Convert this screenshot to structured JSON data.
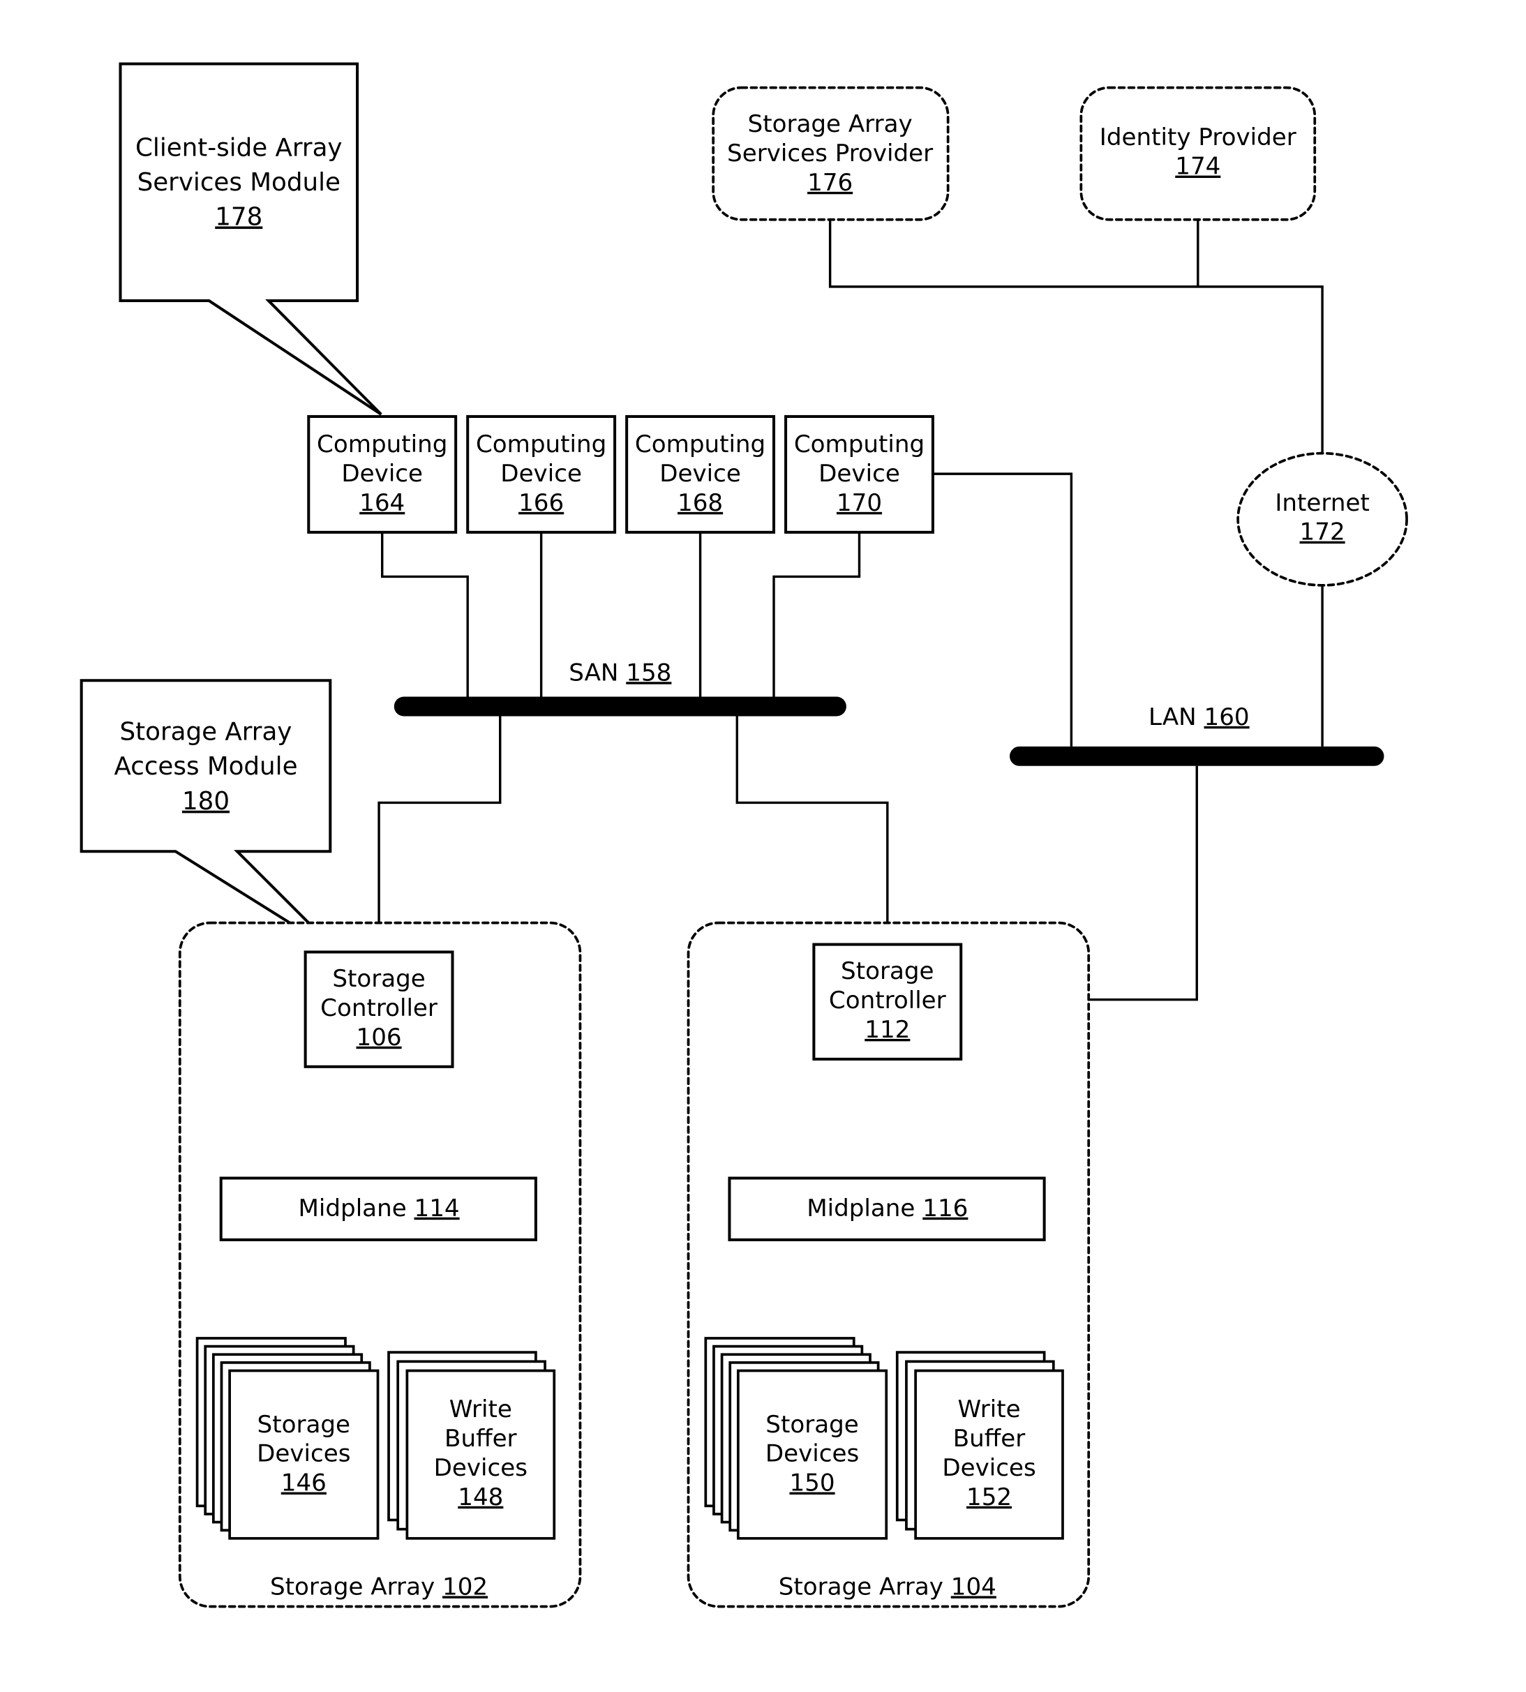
{
  "diagram": {
    "callouts": [
      {
        "id": "client-side-array-services-module",
        "lines": [
          "Client-side Array",
          "Services Module"
        ],
        "ref": "178"
      },
      {
        "id": "storage-array-access-module",
        "lines": [
          "Storage Array",
          "Access Module"
        ],
        "ref": "180"
      }
    ],
    "cloud_services": [
      {
        "id": "storage-array-services-provider",
        "lines": [
          "Storage Array",
          "Services Provider"
        ],
        "ref": "176"
      },
      {
        "id": "identity-provider",
        "lines": [
          "Identity Provider"
        ],
        "ref": "174"
      }
    ],
    "internet": {
      "lines": [
        "Internet"
      ],
      "ref": "172"
    },
    "computing_devices": [
      {
        "lines": [
          "Computing",
          "Device"
        ],
        "ref": "164"
      },
      {
        "lines": [
          "Computing",
          "Device"
        ],
        "ref": "166"
      },
      {
        "lines": [
          "Computing",
          "Device"
        ],
        "ref": "168"
      },
      {
        "lines": [
          "Computing",
          "Device"
        ],
        "ref": "170"
      }
    ],
    "san": {
      "label": "SAN",
      "ref": "158"
    },
    "lan": {
      "label": "LAN",
      "ref": "160"
    },
    "storage_arrays": [
      {
        "label": "Storage Array",
        "ref": "102",
        "controller": {
          "lines": [
            "Storage",
            "Controller"
          ],
          "ref": "106"
        },
        "midplane": {
          "label": "Midplane",
          "ref": "114"
        },
        "storage_devices": {
          "lines": [
            "Storage",
            "Devices"
          ],
          "ref": "146",
          "stack_count": 5
        },
        "write_buffer_devices": {
          "lines": [
            "Write",
            "Buffer",
            "Devices"
          ],
          "ref": "148",
          "stack_count": 3
        }
      },
      {
        "label": "Storage Array",
        "ref": "104",
        "controller": {
          "lines": [
            "Storage",
            "Controller"
          ],
          "ref": "112"
        },
        "midplane": {
          "label": "Midplane",
          "ref": "116"
        },
        "storage_devices": {
          "lines": [
            "Storage",
            "Devices"
          ],
          "ref": "150",
          "stack_count": 5
        },
        "write_buffer_devices": {
          "lines": [
            "Write",
            "Buffer",
            "Devices"
          ],
          "ref": "152",
          "stack_count": 3
        }
      }
    ]
  }
}
